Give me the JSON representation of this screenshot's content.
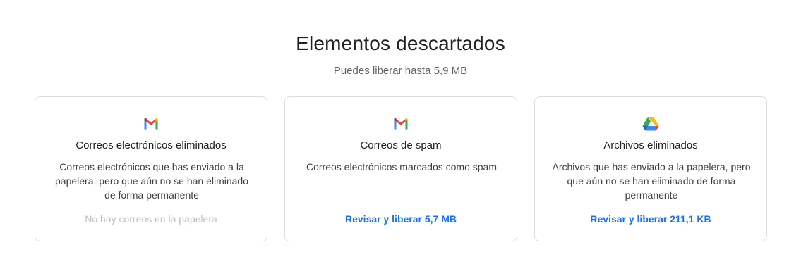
{
  "header": {
    "title": "Elementos descartados",
    "subtitle": "Puedes liberar hasta 5,9 MB"
  },
  "cards": [
    {
      "icon": "gmail-icon",
      "title": "Correos electrónicos eliminados",
      "description": "Correos electrónicos que has enviado a la papelera, pero que aún no se han eliminado de forma permanente",
      "action": "No hay correos en la papelera"
    },
    {
      "icon": "gmail-icon",
      "title": "Correos de spam",
      "description": "Correos electrónicos marcados como spam",
      "action": "Revisar y liberar 5,7 MB"
    },
    {
      "icon": "google-drive-icon",
      "title": "Archivos eliminados",
      "description": "Archivos que has enviado a la papelera, pero que aún no se han eliminado de forma permanente",
      "action": "Revisar y liberar 211,1 KB"
    }
  ],
  "colors": {
    "link": "#1a73e8",
    "disabled": "#bdc1c6",
    "border": "#dadce0"
  }
}
